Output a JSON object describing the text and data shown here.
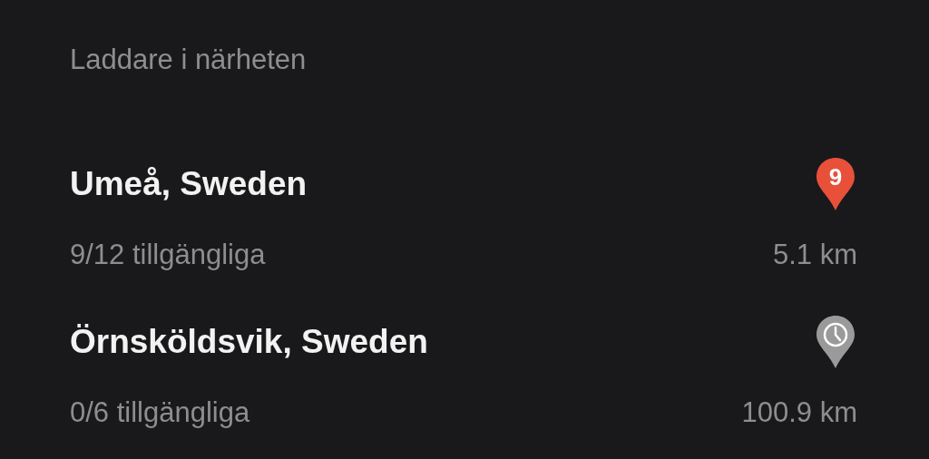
{
  "heading": "Laddare i närheten",
  "chargers": [
    {
      "name": "Umeå, Sweden",
      "pin": {
        "kind": "count",
        "label": "9",
        "color": "#e8503a"
      },
      "availability": "9/12 tillgängliga",
      "distance": "5.1 km"
    },
    {
      "name": "Örnsköldsvik, Sweden",
      "pin": {
        "kind": "clock",
        "color": "#9a9a9a"
      },
      "availability": "0/6 tillgängliga",
      "distance": "100.9 km"
    }
  ]
}
